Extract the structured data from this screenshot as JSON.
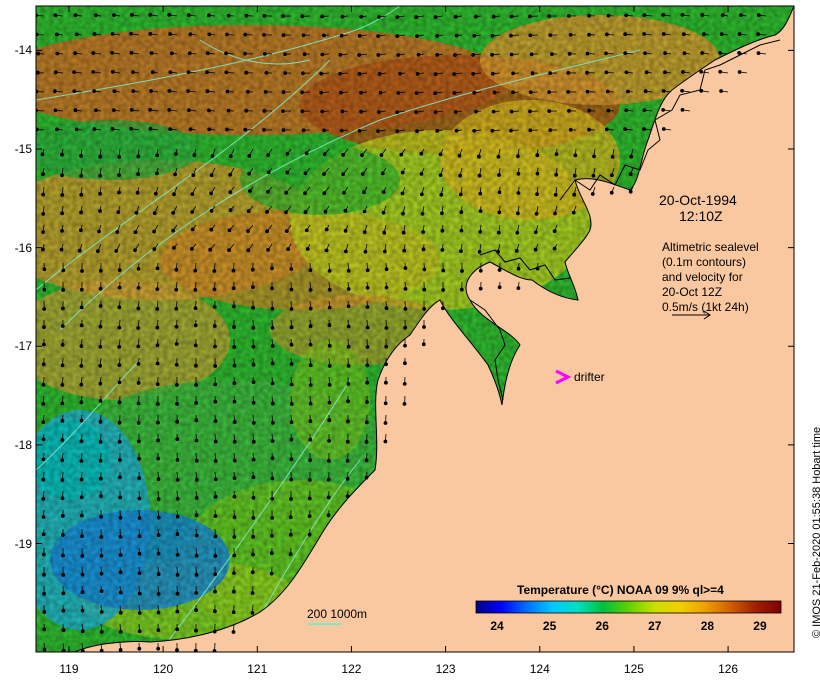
{
  "map": {
    "lon_ticks": [
      "119",
      "120",
      "121",
      "122",
      "123",
      "124",
      "125",
      "126"
    ],
    "lat_ticks": [
      "-14",
      "-15",
      "-16",
      "-17",
      "-18",
      "-19"
    ],
    "extent": {
      "lon_min": 118.65,
      "lon_max": 126.7,
      "lat_min": -20.1,
      "lat_max": -13.55
    }
  },
  "annotations": {
    "date": "20-Oct-1994",
    "time": "12:10Z",
    "altimetry_lines": [
      "Altimetric sealevel",
      "(0.1m contours)",
      "and velocity for",
      "20-Oct 12Z",
      "0.5m/s (1kt 24h)"
    ],
    "drifter_label": "drifter",
    "drifter_color": "#ff00ff",
    "depth_scale_label": "200  1000m"
  },
  "colorbar": {
    "title": "Temperature (°C) NOAA 09 9% ql>=4",
    "ticks": [
      "24",
      "25",
      "26",
      "27",
      "28",
      "29"
    ],
    "range": [
      23.6,
      29.4
    ],
    "colors": [
      "#000080",
      "#0000ff",
      "#0070ff",
      "#00c8ff",
      "#00e0c0",
      "#00c040",
      "#60d000",
      "#c8e000",
      "#f0d000",
      "#f0a000",
      "#d06000",
      "#a02000",
      "#800000"
    ]
  },
  "colors": {
    "land": "#fac8a0",
    "contour": "#80e8c8"
  },
  "credit": "© IMOS 21-Feb-2020 01:55:38 Hobart time"
}
